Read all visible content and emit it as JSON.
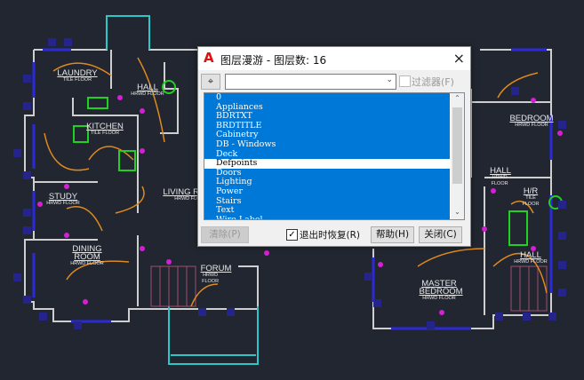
{
  "drawing": {
    "rooms": [
      {
        "name": "LAUNDRY",
        "floor": "TILE FLOOR"
      },
      {
        "name": "KITCHEN",
        "floor": "TILE FLOOR"
      },
      {
        "name": "HALL",
        "floor": "HRWD FLOOR"
      },
      {
        "name": "STUDY",
        "floor": "HRWD FLOOR"
      },
      {
        "name": "LIVING ROOM",
        "floor": "HRWD FLOOR"
      },
      {
        "name": "DINING ROOM",
        "floor": "HRWD FLOOR"
      },
      {
        "name": "FORUM",
        "floor": "HRWD FLOOR"
      },
      {
        "name": "BEDROOM",
        "floor": "HRWD FLOOR"
      },
      {
        "name": "HALL",
        "floor": "HRWD FLOOR"
      },
      {
        "name": "H/R",
        "floor": "TILE FLOOR"
      },
      {
        "name": "HALL",
        "floor": "HRWD FLOOR"
      },
      {
        "name": "MASTER BEDROOM",
        "floor": "HRWD FLOOR"
      }
    ],
    "colors": {
      "wall": "#d8d8d8",
      "window": "#2a2ad8",
      "door": "#9aa0aa",
      "light": "#e08a1e",
      "outlet": "#d41fd4",
      "appliance": "#22d022",
      "porch": "#2ac8c8"
    }
  },
  "dialog": {
    "title": "图层漫游 - 图层数: 16",
    "close_icon": "×",
    "pin_icon": "⌖",
    "filter_value": "",
    "filter_label": "过滤器(F)",
    "layers": [
      "0",
      "Appliances",
      "BDRTXT",
      "BRDTITLE",
      "Cabinetry",
      "DB - Windows",
      "Deck",
      "Defpoints",
      "Doors",
      "Lighting",
      "Power",
      "Stairs",
      "Text",
      "Wire Label"
    ],
    "unselected_layer": "Defpoints",
    "clear_label": "清除(P)",
    "restore_label": "退出时恢复(R)",
    "restore_checked": true,
    "help_label": "帮助(H)",
    "close_label": "关闭(C)"
  }
}
